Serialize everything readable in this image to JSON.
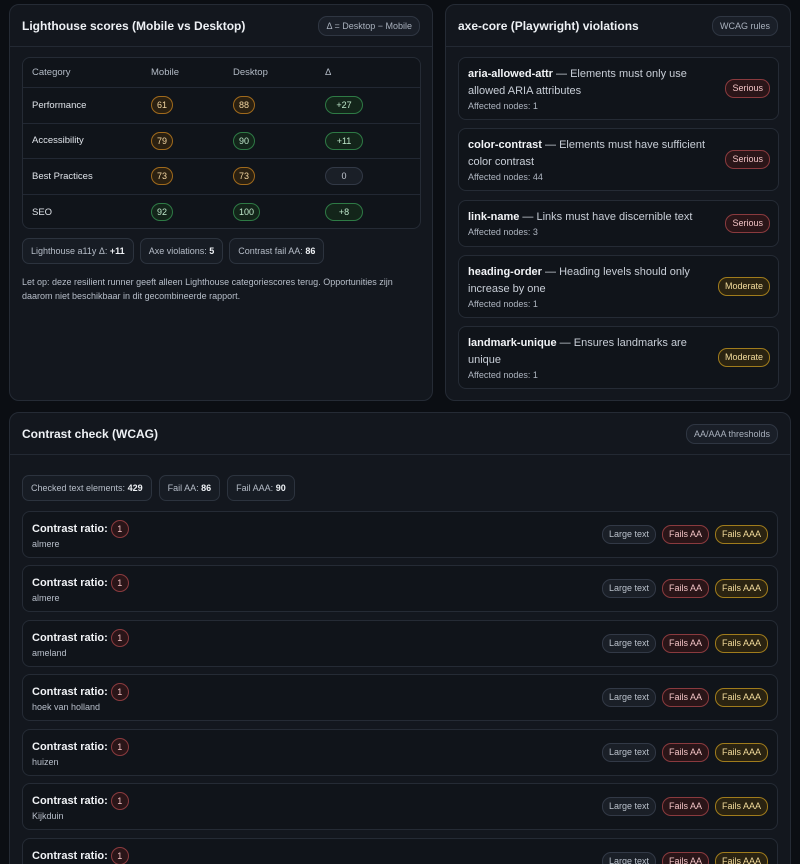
{
  "lighthouse": {
    "title": "Lighthouse scores (Mobile vs Desktop)",
    "badge": "Δ = Desktop − Mobile",
    "headers": [
      "Category",
      "Mobile",
      "Desktop",
      "Δ"
    ],
    "rows": [
      {
        "category": "Performance",
        "mobile": "61",
        "desktop": "88",
        "delta": "+27"
      },
      {
        "category": "Accessibility",
        "mobile": "79",
        "desktop": "90",
        "delta": "+11"
      },
      {
        "category": "Best Practices",
        "mobile": "73",
        "desktop": "73",
        "delta": "0"
      },
      {
        "category": "SEO",
        "mobile": "92",
        "desktop": "100",
        "delta": "+8"
      }
    ],
    "summary": [
      {
        "label": "Lighthouse a11y Δ:",
        "value": "+11"
      },
      {
        "label": "Axe violations:",
        "value": "5"
      },
      {
        "label": "Contrast fail AA:",
        "value": "86"
      }
    ],
    "note": "Let op: deze resilient runner geeft alleen Lighthouse categoriescores terug. Opportunities zijn daarom niet beschikbaar in dit gecombineerde rapport."
  },
  "axe": {
    "title": "axe-core (Playwright) violations",
    "badge": "WCAG rules",
    "violations": [
      {
        "rule": "aria-allowed-attr",
        "desc": " — Elements must only use allowed ARIA attributes",
        "nodes": "Affected nodes: 1",
        "severity": "Serious"
      },
      {
        "rule": "color-contrast",
        "desc": " — Elements must have sufficient color contrast",
        "nodes": "Affected nodes: 44",
        "severity": "Serious"
      },
      {
        "rule": "link-name",
        "desc": " — Links must have discernible text",
        "nodes": "Affected nodes: 3",
        "severity": "Serious"
      },
      {
        "rule": "heading-order",
        "desc": " — Heading levels should only increase by one",
        "nodes": "Affected nodes: 1",
        "severity": "Moderate"
      },
      {
        "rule": "landmark-unique",
        "desc": " — Ensures landmarks are unique",
        "nodes": "Affected nodes: 1",
        "severity": "Moderate"
      }
    ]
  },
  "contrast": {
    "title": "Contrast check (WCAG)",
    "badge": "AA/AAA thresholds",
    "stats": [
      {
        "label": "Checked text elements:",
        "value": "429"
      },
      {
        "label": "Fail AA:",
        "value": "86"
      },
      {
        "label": "Fail AAA:",
        "value": "90"
      }
    ],
    "row_label": "Contrast ratio:",
    "tags": {
      "large": "Large text",
      "fail_aa": "Fails AA",
      "fail_aaa": "Fails AAA"
    },
    "rows": [
      {
        "ratio": "1",
        "text": "almere"
      },
      {
        "ratio": "1",
        "text": "almere"
      },
      {
        "ratio": "1",
        "text": "ameland"
      },
      {
        "ratio": "1",
        "text": "hoek van holland"
      },
      {
        "ratio": "1",
        "text": "huizen"
      },
      {
        "ratio": "1",
        "text": "Kijkduin"
      },
      {
        "ratio": "1",
        "text": ""
      }
    ]
  }
}
